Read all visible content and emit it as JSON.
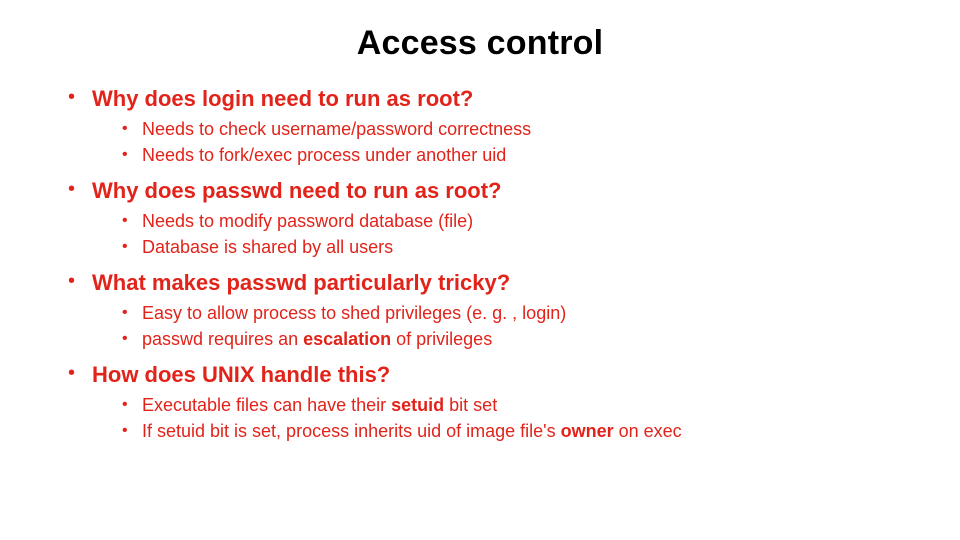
{
  "title": "Access control",
  "sections": [
    {
      "question": "Why does login need to run as root?",
      "items": [
        {
          "pre": "Needs to check username/password correctness",
          "bold": "",
          "post": ""
        },
        {
          "pre": "Needs to fork/exec process under another uid",
          "bold": "",
          "post": ""
        }
      ]
    },
    {
      "question": "Why does passwd need to run as root?",
      "items": [
        {
          "pre": "Needs to modify password database (file)",
          "bold": "",
          "post": ""
        },
        {
          "pre": "Database is shared by all users",
          "bold": "",
          "post": ""
        }
      ]
    },
    {
      "question": "What makes passwd particularly tricky?",
      "items": [
        {
          "pre": "Easy to allow process to shed privileges (e. g. , login)",
          "bold": "",
          "post": ""
        },
        {
          "pre": "passwd requires an ",
          "bold": "escalation",
          "post": " of privileges"
        }
      ]
    },
    {
      "question": "How does UNIX handle this?",
      "items": [
        {
          "pre": "Executable files can have their ",
          "bold": "setuid",
          "post": " bit set"
        },
        {
          "pre": "If setuid bit is set, process inherits uid of image file's ",
          "bold": "owner",
          "post": " on exec"
        }
      ]
    }
  ]
}
